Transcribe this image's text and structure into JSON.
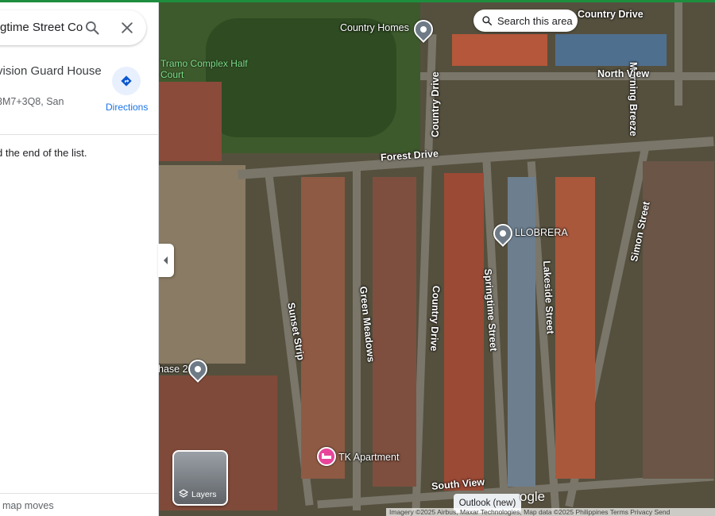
{
  "search": {
    "value": "gtime Street Co"
  },
  "place": {
    "title": "vision Guard House",
    "plus_code": "3M7+3Q8, San"
  },
  "directions": {
    "label": "Directions"
  },
  "list": {
    "end_text": "d the end of the list."
  },
  "footer": {
    "note": "map moves"
  },
  "map": {
    "search_area_label": "Search this area",
    "layers_label": "Layers",
    "toast": "Outlook (new)",
    "google_fragment": "ogle",
    "attribution": "Imagery ©2025 Airbus, Maxar Technologies, Map data ©2025    Philippines    Terms    Privacy    Send",
    "streets": {
      "country_drive_top": "Country Drive",
      "morning_breeze": "Morning Breeze",
      "north_view": "North View",
      "country_drive_vertical": "Country Drive",
      "forest_drive": "Forest Drive",
      "simon_street": "Simon Street",
      "springtime_street": "Springtime Street",
      "lakeside_street": "Lakeside Street",
      "green_meadows": "Green Meadows",
      "sunset_strip": "Sunset Strip",
      "country_drive_lower": "Country Drive",
      "south_view": "South View"
    },
    "pois": {
      "country_homes": "Country Homes",
      "tramo_court": "Tramo Complex Half Court",
      "llobrera": "LLOBRERA",
      "phase2": "hase 2",
      "tk_apartment": "TK Apartment"
    }
  }
}
